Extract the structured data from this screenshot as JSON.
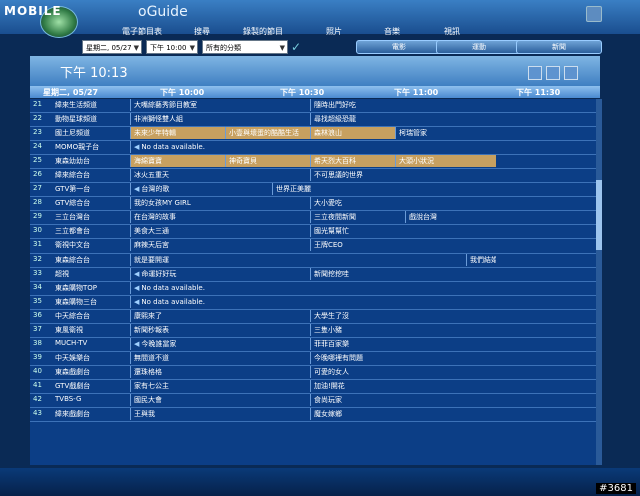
{
  "brand": {
    "logo": "MOBILE",
    "suffix": "oGuide"
  },
  "nav": [
    "電子節目表",
    "搜尋",
    "錄製的節目",
    "照片",
    "音樂",
    "視訊"
  ],
  "filters": {
    "date": "星期二, 05/27",
    "time": "下午 10:00",
    "category": "所有的分類"
  },
  "categories": [
    "電影",
    "運動",
    "新聞"
  ],
  "current_time": "下午 10:13",
  "header": {
    "date": "星期二, 05/27",
    "t1": "下午 10:00",
    "t2": "下午 10:30",
    "t3": "下午 11:00",
    "t4": "下午 11:30"
  },
  "watermark": "#3681",
  "rows": [
    {
      "num": "21",
      "name": "緯來生活頻道",
      "progs": [
        {
          "t": "大嘴綜藝秀節目教室",
          "l": 100,
          "w": 180
        },
        {
          "t": "隨時出門好吃",
          "l": 280,
          "w": 186
        }
      ]
    },
    {
      "num": "22",
      "name": "動物星球頻道",
      "progs": [
        {
          "t": "非洲獅怪雙人組",
          "l": 100,
          "w": 180
        },
        {
          "t": "尋找超級恐龍",
          "l": 280,
          "w": 186
        }
      ]
    },
    {
      "num": "23",
      "name": "國土尼頻道",
      "progs": [
        {
          "t": "未來少年特輯",
          "l": 100,
          "w": 95,
          "hl": true
        },
        {
          "t": "小壹與壞蛋的酷酷生活",
          "l": 195,
          "w": 85,
          "hl": true
        },
        {
          "t": "森林浪山",
          "l": 280,
          "w": 85,
          "hl": true
        },
        {
          "t": "柯瑞管家",
          "l": 365,
          "w": 101
        }
      ]
    },
    {
      "num": "24",
      "name": "MOMO親子台",
      "progs": [
        {
          "t": "No data available.",
          "l": 100,
          "w": 366,
          "lt": true
        }
      ]
    },
    {
      "num": "25",
      "name": "東森幼幼台",
      "progs": [
        {
          "t": "海綿寶寶",
          "l": 100,
          "w": 95,
          "hl": true
        },
        {
          "t": "神奇寶貝",
          "l": 195,
          "w": 85,
          "hl": true
        },
        {
          "t": "希天烈大百科",
          "l": 280,
          "w": 85,
          "hl": true
        },
        {
          "t": "大頭小狀況",
          "l": 365,
          "w": 101,
          "hl": true
        }
      ]
    },
    {
      "num": "26",
      "name": "緯來綜合台",
      "progs": [
        {
          "t": "冰火五重天",
          "l": 100,
          "w": 180
        },
        {
          "t": "不可思議的世界",
          "l": 280,
          "w": 186
        }
      ]
    },
    {
      "num": "27",
      "name": "GTV第一台",
      "progs": [
        {
          "t": "台灣的歌",
          "l": 100,
          "w": 142,
          "lt": true
        },
        {
          "t": "世界正美麗",
          "l": 242,
          "w": 224
        }
      ]
    },
    {
      "num": "28",
      "name": "GTV綜合台",
      "progs": [
        {
          "t": "我的女孩MY GIRL",
          "l": 100,
          "w": 180
        },
        {
          "t": "大小愛吃",
          "l": 280,
          "w": 186
        }
      ]
    },
    {
      "num": "29",
      "name": "三立台灣台",
      "progs": [
        {
          "t": "在台灣的故事",
          "l": 100,
          "w": 180
        },
        {
          "t": "三立夜間新聞",
          "l": 280,
          "w": 95
        },
        {
          "t": "戲說台灣",
          "l": 375,
          "w": 91
        }
      ]
    },
    {
      "num": "30",
      "name": "三立都會台",
      "progs": [
        {
          "t": "美食大三通",
          "l": 100,
          "w": 180
        },
        {
          "t": "國光幫幫忙",
          "l": 280,
          "w": 186
        }
      ]
    },
    {
      "num": "31",
      "name": "衛視中文台",
      "progs": [
        {
          "t": "麻辣天后宮",
          "l": 100,
          "w": 180
        },
        {
          "t": "王牌CEO",
          "l": 280,
          "w": 186
        }
      ]
    },
    {
      "num": "32",
      "name": "東森綜合台",
      "progs": [
        {
          "t": "就是要開運",
          "l": 100,
          "w": 336
        },
        {
          "t": "我們結婚吧",
          "l": 436,
          "w": 30
        }
      ]
    },
    {
      "num": "33",
      "name": "超視",
      "progs": [
        {
          "t": "命運好好玩",
          "l": 100,
          "w": 180,
          "lt": true
        },
        {
          "t": "新聞挖挖哇",
          "l": 280,
          "w": 186
        }
      ]
    },
    {
      "num": "34",
      "name": "東森購物TOP",
      "progs": [
        {
          "t": "No data available.",
          "l": 100,
          "w": 366,
          "lt": true
        }
      ]
    },
    {
      "num": "35",
      "name": "東森購物三台",
      "progs": [
        {
          "t": "No data available.",
          "l": 100,
          "w": 366,
          "lt": true
        }
      ]
    },
    {
      "num": "36",
      "name": "中天綜合台",
      "progs": [
        {
          "t": "康熙來了",
          "l": 100,
          "w": 180
        },
        {
          "t": "大學生了沒",
          "l": 280,
          "w": 186
        }
      ]
    },
    {
      "num": "37",
      "name": "東風衛視",
      "progs": [
        {
          "t": "新聞秒報表",
          "l": 100,
          "w": 180
        },
        {
          "t": "三隻小豬",
          "l": 280,
          "w": 186
        }
      ]
    },
    {
      "num": "38",
      "name": "MUCH-TV",
      "progs": [
        {
          "t": "今晚誰當家",
          "l": 100,
          "w": 180,
          "lt": true
        },
        {
          "t": "菲菲百家樂",
          "l": 280,
          "w": 186
        }
      ]
    },
    {
      "num": "39",
      "name": "中天娛樂台",
      "progs": [
        {
          "t": "無間道不道",
          "l": 100,
          "w": 180
        },
        {
          "t": "今晚哪裡有問題",
          "l": 280,
          "w": 186
        }
      ]
    },
    {
      "num": "40",
      "name": "東森戲劇台",
      "progs": [
        {
          "t": "還珠格格",
          "l": 100,
          "w": 180
        },
        {
          "t": "可愛的女人",
          "l": 280,
          "w": 186
        }
      ]
    },
    {
      "num": "41",
      "name": "GTV戲劇台",
      "progs": [
        {
          "t": "家有七公主",
          "l": 100,
          "w": 180
        },
        {
          "t": "加油!開花",
          "l": 280,
          "w": 186
        }
      ]
    },
    {
      "num": "42",
      "name": "TVBS-G",
      "progs": [
        {
          "t": "國民大會",
          "l": 100,
          "w": 180
        },
        {
          "t": "食尚玩家",
          "l": 280,
          "w": 186
        }
      ]
    },
    {
      "num": "43",
      "name": "緯來戲劇台",
      "progs": [
        {
          "t": "王與我",
          "l": 100,
          "w": 180
        },
        {
          "t": "魔女嫁鄉",
          "l": 280,
          "w": 186
        }
      ]
    }
  ]
}
